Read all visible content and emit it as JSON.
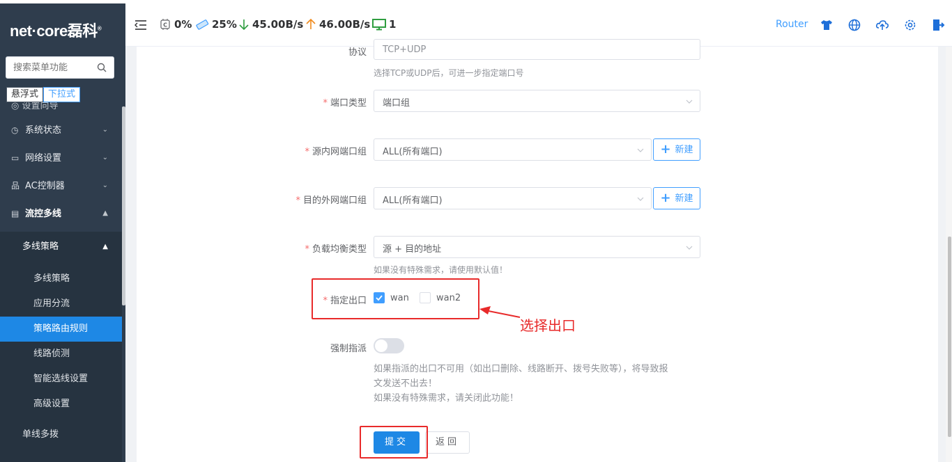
{
  "brand": {
    "logo_text": "net·core磊科",
    "reg_mark": "®"
  },
  "sidebar": {
    "search_placeholder": "搜索菜单功能",
    "mode_float": "悬浮式",
    "mode_dropdown": "下拉式",
    "partial_item": "设置向导",
    "items": [
      {
        "label": "系统状态",
        "icon": "dashboard-icon"
      },
      {
        "label": "网络设置",
        "icon": "monitor-icon"
      },
      {
        "label": "AC控制器",
        "icon": "network-tree-icon"
      },
      {
        "label": "流控多线",
        "icon": "multi-line-icon"
      }
    ],
    "submenu_title": "多线策略",
    "submenu_items": [
      {
        "label": "多线策略"
      },
      {
        "label": "应用分流"
      },
      {
        "label": "策略路由规则"
      },
      {
        "label": "线路侦测"
      },
      {
        "label": "智能选线设置"
      },
      {
        "label": "高级设置"
      }
    ],
    "next_items": [
      {
        "label": "单线多拨"
      }
    ]
  },
  "header": {
    "cpu": "0%",
    "memory": "25%",
    "download": "45.00B/s",
    "upload": "46.00B/s",
    "devices": "1",
    "mode_label": "Router",
    "colors": {
      "download": "#2e9d3f",
      "upload": "#f08a1c",
      "accent": "#409eff"
    }
  },
  "form": {
    "protocol": {
      "label": "协议",
      "value": "TCP+UDP",
      "hint": "选择TCP或UDP后，可进一步指定端口号"
    },
    "port_type": {
      "label": "端口类型",
      "value": "端口组"
    },
    "src_port_group": {
      "label": "源内网端口组",
      "value": "ALL(所有端口)",
      "new_btn": "新建"
    },
    "dst_port_group": {
      "label": "目的外网端口组",
      "value": "ALL(所有端口)",
      "new_btn": "新建"
    },
    "lb_type": {
      "label": "负载均衡类型",
      "value": "源 + 目的地址",
      "hint": "如果没有特殊需求，请使用默认值！"
    },
    "egress": {
      "label": "指定出口",
      "options": [
        {
          "label": "wan",
          "checked": true
        },
        {
          "label": "wan2",
          "checked": false
        }
      ]
    },
    "force_assign": {
      "label": "强制指派",
      "enabled": false,
      "hint1": "如果指派的出口不可用（如出口删除、线路断开、拨号失败等），将导致报",
      "hint2": "文发送不出去！",
      "hint3": "如果没有特殊需求，请关闭此功能！"
    },
    "submit_label": "提交",
    "back_label": "返回"
  },
  "annotation": {
    "text": "选择出口",
    "color": "#e82a2a"
  }
}
